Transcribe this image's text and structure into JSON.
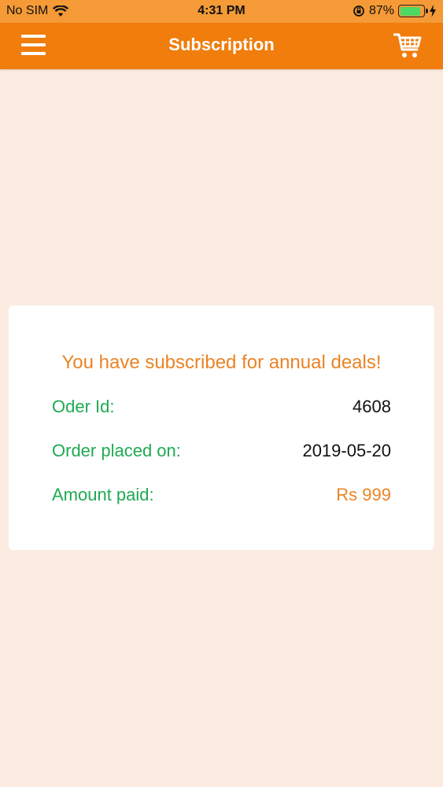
{
  "status_bar": {
    "carrier": "No SIM",
    "time": "4:31 PM",
    "battery_percent": "87%",
    "battery_level": 0.87
  },
  "nav": {
    "title": "Subscription",
    "menu_icon": "hamburger-menu-icon",
    "cart_icon": "shopping-cart-icon"
  },
  "card": {
    "heading": "You have subscribed for annual deals!",
    "rows": [
      {
        "label": "Oder Id:",
        "value": "4608"
      },
      {
        "label": "Order placed on:",
        "value": "2019-05-20"
      },
      {
        "label": "Amount paid:",
        "value": "Rs 999"
      }
    ]
  },
  "colors": {
    "status_bar": "#f59a36",
    "nav_bar": "#f07d0c",
    "background": "#fbebe0",
    "accent_orange": "#e98425",
    "label_green": "#1faa52"
  }
}
